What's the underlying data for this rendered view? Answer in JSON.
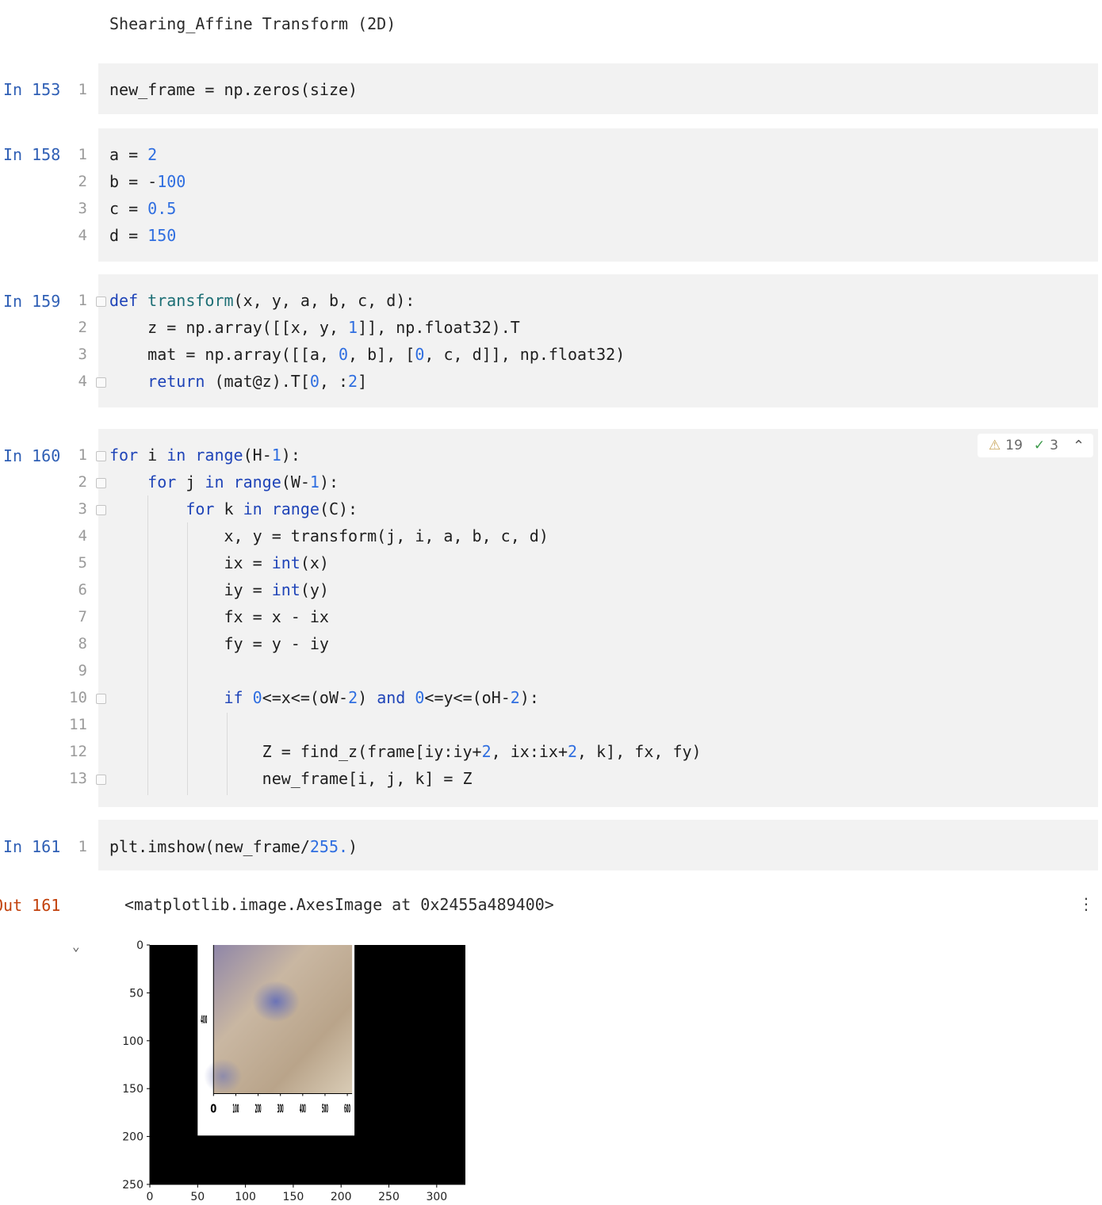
{
  "markdown_title": "Shearing_Affine Transform (2D)",
  "cells": [
    {
      "prompt": "In 153",
      "lines": [
        "new_frame = np.zeros(size)"
      ]
    },
    {
      "prompt": "In 158",
      "lines": [
        "a = 2",
        "b = -100",
        "c = 0.5",
        "d = 150"
      ]
    },
    {
      "prompt": "In 159",
      "lines": [
        "def transform(x, y, a, b, c, d):",
        "    z = np.array([[x, y, 1]], np.float32).T",
        "    mat = np.array([[a, 0, b], [0, c, d]], np.float32)",
        "    return (mat@z).T[0, :2]"
      ]
    },
    {
      "prompt": "In 160",
      "lines": [
        "for i in range(H-1):",
        "    for j in range(W-1):",
        "        for k in range(C):",
        "            x, y = transform(j, i, a, b, c, d)",
        "            ix = int(x)",
        "            iy = int(y)",
        "            fx = x - ix",
        "            fy = y - iy",
        "",
        "            if 0<=x<=(oW-2) and 0<=y<=(oH-2):",
        "",
        "                Z = find_z(frame[iy:iy+2, ix:ix+2, k], fx, fy)",
        "                new_frame[i, j, k] = Z"
      ]
    },
    {
      "prompt": "In 161",
      "lines": [
        "plt.imshow(new_frame/255.)"
      ]
    }
  ],
  "inspections": {
    "warnings": "19",
    "weak_warnings": "3"
  },
  "output": {
    "prompt": "Out 161",
    "text": "<matplotlib.image.AxesImage at 0x2455a489400>"
  },
  "chart_data": {
    "type": "image",
    "xticks": [
      "0",
      "50",
      "100",
      "150",
      "200",
      "250",
      "300"
    ],
    "yticks": [
      "0",
      "50",
      "100",
      "150",
      "200",
      "250"
    ],
    "xlim": [
      0,
      330
    ],
    "ylim": [
      250,
      0
    ],
    "background": "#000000",
    "inner_image": {
      "x_range": [
        50,
        214
      ],
      "y_range": [
        0,
        199
      ],
      "inner_xticks": [
        "0",
        "100",
        "200",
        "300",
        "400",
        "500",
        "600"
      ],
      "inner_ytick": "400"
    }
  },
  "colors": {
    "prompt_in": "#2f5fb5",
    "prompt_out": "#c2410c",
    "keyword": "#1f44b8",
    "number": "#2f6ee0",
    "cell_bg": "#f2f2f2"
  },
  "icons": [
    "fold-marker-icon",
    "warning-icon",
    "check-icon",
    "chevron-up-icon",
    "more-vertical-icon",
    "chevron-down-icon"
  ]
}
